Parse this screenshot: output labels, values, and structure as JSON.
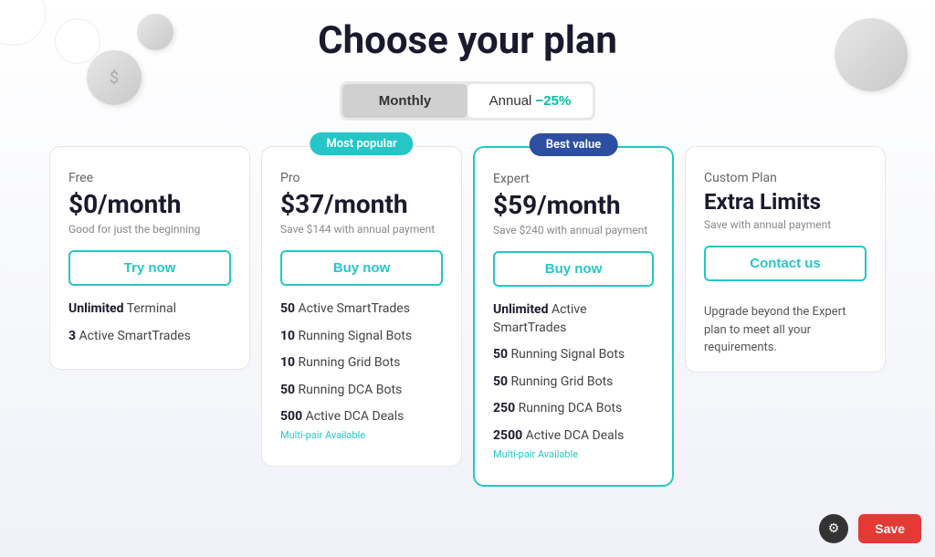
{
  "page": {
    "title": "Choose your plan"
  },
  "toggle": {
    "monthly_label": "Monthly",
    "annual_label": "Annual",
    "discount_label": "−25%",
    "active": "monthly"
  },
  "plans": [
    {
      "id": "free",
      "type": "Free",
      "price": "$0/month",
      "savings": "Good for just the beginning",
      "btn_label": "Try now",
      "badge": null,
      "features": [
        {
          "bold": "Unlimited",
          "text": " Terminal"
        },
        {
          "bold": "3",
          "text": " Active SmartTrades"
        }
      ],
      "multi_pair": null,
      "custom_desc": null
    },
    {
      "id": "pro",
      "type": "Pro",
      "price": "$37/month",
      "savings": "Save $144 with annual payment",
      "btn_label": "Buy now",
      "badge": "Most popular",
      "badge_type": "popular",
      "features": [
        {
          "bold": "50",
          "text": " Active SmartTrades"
        },
        {
          "bold": "10",
          "text": " Running Signal Bots"
        },
        {
          "bold": "10",
          "text": " Running Grid Bots"
        },
        {
          "bold": "50",
          "text": " Running DCA Bots"
        },
        {
          "bold": "500",
          "text": " Active DCA Deals",
          "multi_pair": "Multi-pair Available"
        }
      ],
      "custom_desc": null
    },
    {
      "id": "expert",
      "type": "Expert",
      "price": "$59/month",
      "savings": "Save $240 with annual payment",
      "btn_label": "Buy now",
      "badge": "Best value",
      "badge_type": "best",
      "features": [
        {
          "bold": "Unlimited",
          "text": " Active SmartTrades"
        },
        {
          "bold": "50",
          "text": " Running Signal Bots"
        },
        {
          "bold": "50",
          "text": " Running Grid Bots"
        },
        {
          "bold": "250",
          "text": " Running DCA Bots"
        },
        {
          "bold": "2500",
          "text": " Active DCA Deals",
          "multi_pair": "Multi-pair Available"
        }
      ],
      "custom_desc": null
    },
    {
      "id": "custom",
      "type": "Custom Plan",
      "price": "Extra Limits",
      "savings": "Save with annual payment",
      "btn_label": "Contact us",
      "badge": null,
      "features": [],
      "custom_desc": "Upgrade beyond the Expert plan to meet all your requirements."
    }
  ],
  "footer": {
    "save_label": "Save",
    "settings_icon": "⚙"
  }
}
